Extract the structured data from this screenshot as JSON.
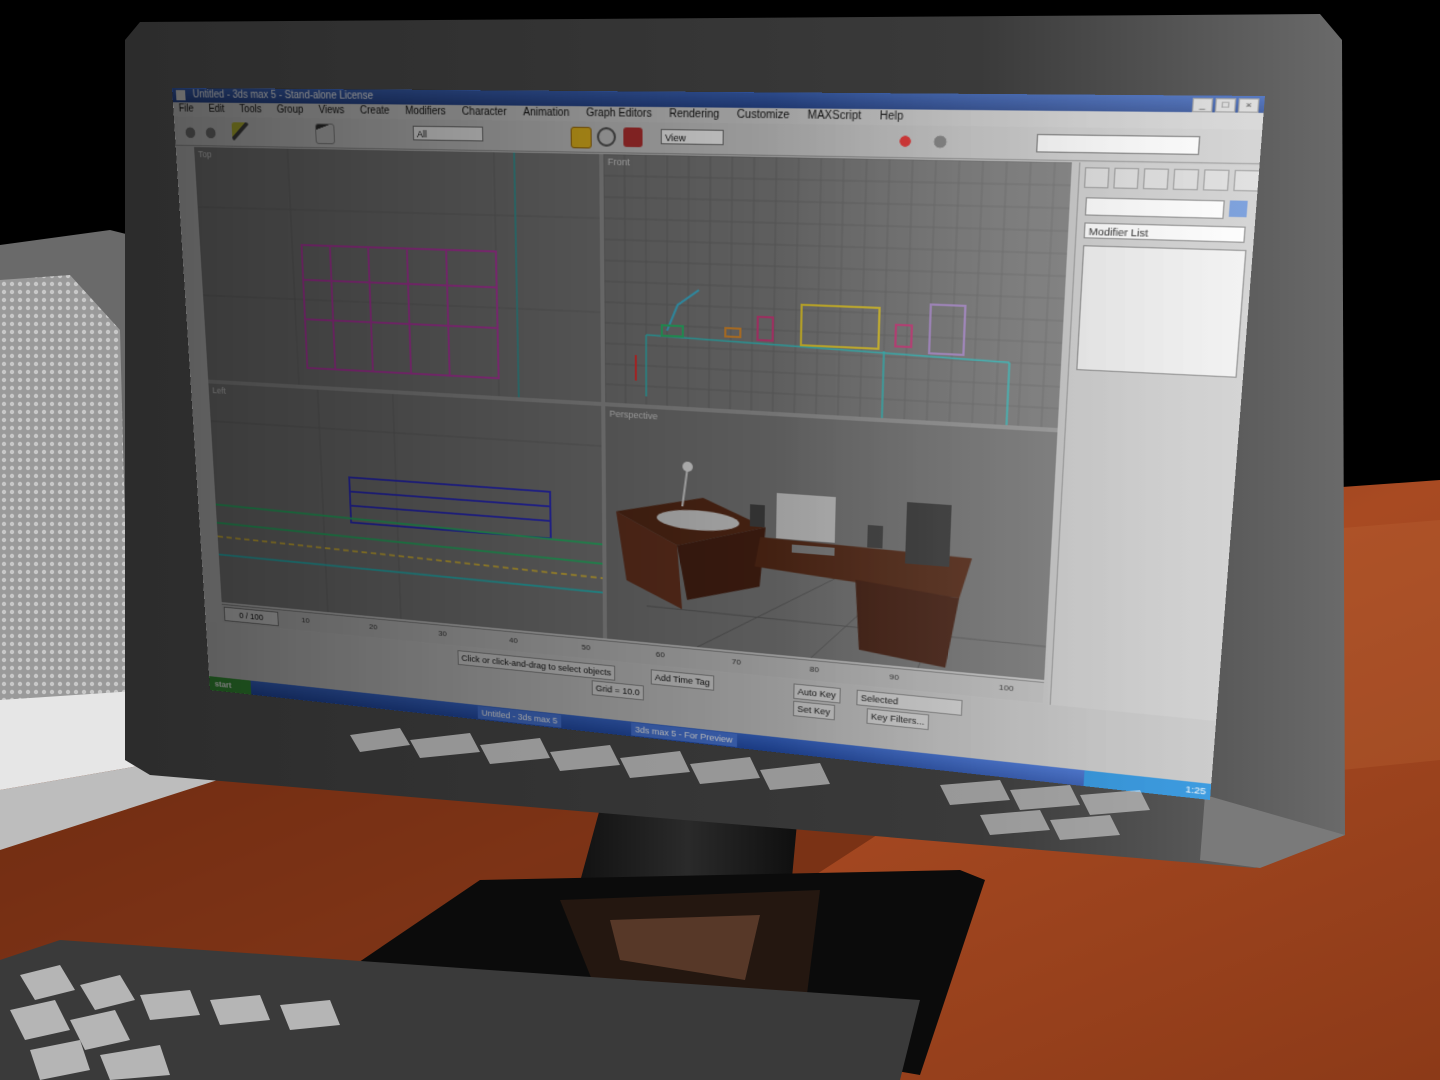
{
  "app": {
    "title": "Untitled - 3ds max 5 - Stand-alone License",
    "window_buttons": [
      "_",
      "□",
      "×"
    ]
  },
  "menu": [
    "File",
    "Edit",
    "Tools",
    "Group",
    "Views",
    "Create",
    "Modifiers",
    "Character",
    "Animation",
    "Graph Editors",
    "Rendering",
    "Customize",
    "MAXScript",
    "Help"
  ],
  "toolbar": {
    "selection_filter": "All",
    "reference_coord": "View",
    "icons": [
      "undo-icon",
      "redo-icon",
      "link-icon",
      "select-icon",
      "move-icon",
      "rotate-icon",
      "scale-icon",
      "render-icon",
      "teapot-icon"
    ]
  },
  "viewports": {
    "top_left": "Top",
    "top_right": "Front",
    "bottom_left": "Left",
    "bottom_right": "Perspective"
  },
  "command_panel": {
    "modifier_list": "Modifier List",
    "object_color": "#6a93d8"
  },
  "timeline": {
    "slider": "0 / 100",
    "ticks": [
      "10",
      "20",
      "30",
      "40",
      "50",
      "60",
      "70",
      "80",
      "90",
      "100"
    ]
  },
  "status": {
    "prompt": "Click or click-and-drag to select objects",
    "add_time_tag": "Add Time Tag",
    "auto_key": "Auto Key",
    "set_key": "Set Key",
    "selected": "Selected",
    "key_filters": "Key Filters...",
    "grid": "Grid = 10.0"
  },
  "taskbar": {
    "start": "start",
    "tasks": [
      "Untitled - 3ds max 5",
      "3ds max 5 - For Preview"
    ],
    "clock": "1:25"
  },
  "colors": {
    "accent_title": "#2a4a94",
    "active_viewport": "#e8d44a",
    "desk_wood": "#b5532a"
  }
}
